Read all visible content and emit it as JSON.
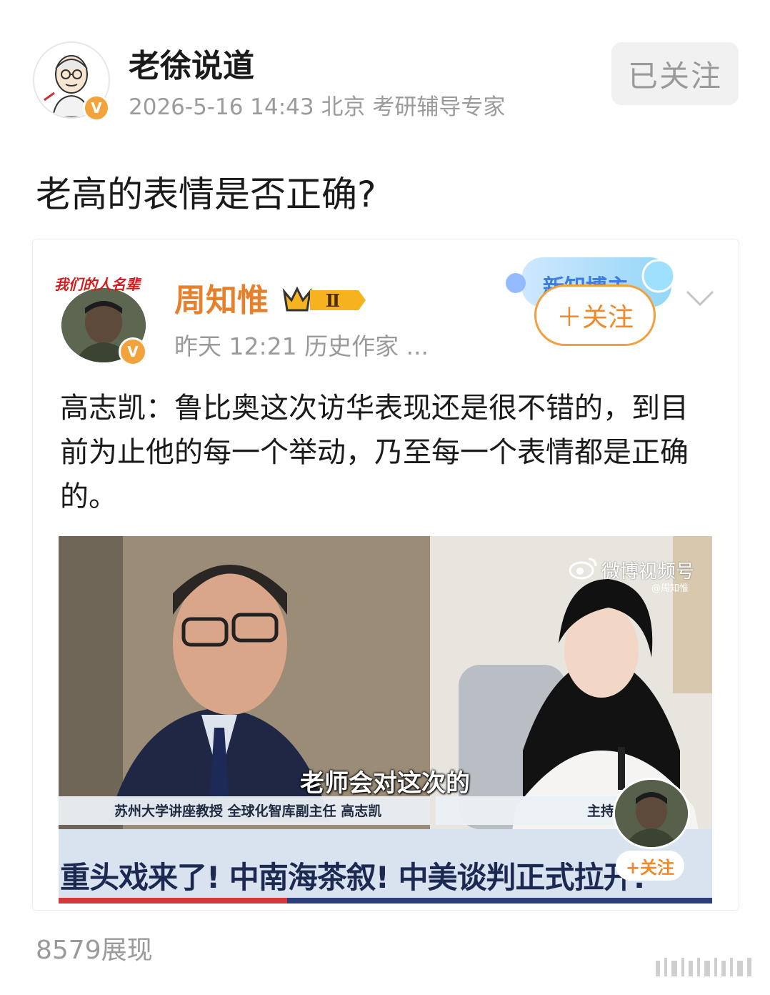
{
  "post": {
    "author": "老徐说道",
    "meta": "2026-5-16 14:43 北京 考研辅导专家",
    "follow_label": "已关注",
    "verified_badge": "V",
    "text": "老高的表情是否正确?",
    "views": "8579展现"
  },
  "repost": {
    "author": "周知惟",
    "level_badge": "Ⅱ",
    "meta": "昨天 12:21   历史作家 ...",
    "follow_label": "＋关注",
    "verified_badge": "V",
    "avatar_text": "我们的人名辈",
    "text": "高志凯：鲁比奥这次访华表现还是很不错的，到目前为止他的每一个举动，乃至每一个表情都是正确的。",
    "banner_text": "新知博主"
  },
  "video": {
    "watermark": "微博视频号",
    "watermark_handle": "@周知惟",
    "subtitle": "老师会对这次的",
    "caption_left": "苏州大学讲座教授 全球化智库副主任 高志凯",
    "caption_right": "主持",
    "headline": "重头戏来了! 中南海茶叙! 中美谈判正式拉开!",
    "follow_label": "+关注"
  },
  "colors": {
    "accent_orange": "#e7802a",
    "meta_gray": "#9b9b9b",
    "headline_blue": "#1c2a52"
  }
}
